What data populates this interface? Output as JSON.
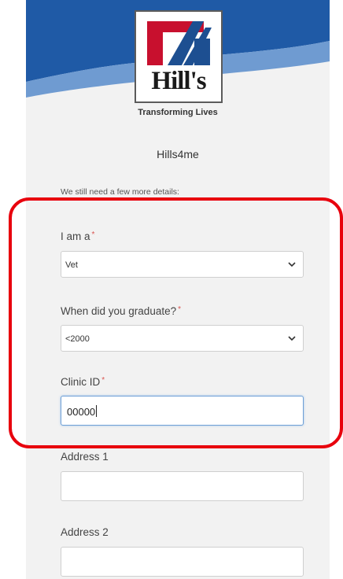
{
  "brand": {
    "logo_text": "Hill's",
    "tagline": "Transforming Lives",
    "colors": {
      "banner_blue": "#1f5aa6",
      "banner_light": "#6f9bd1",
      "logo_red": "#c8102e",
      "logo_blue": "#1d4f91"
    }
  },
  "site_name": "Hills4me",
  "intro": "We still need a few more details:",
  "form": {
    "role": {
      "label": "I am a",
      "required": "*",
      "value": "Vet"
    },
    "graduated": {
      "label": "When did you graduate?",
      "required": "*",
      "value": "<2000"
    },
    "clinic_id": {
      "label": "Clinic ID",
      "required": "*",
      "value": "00000"
    },
    "address1": {
      "label": "Address 1",
      "value": ""
    },
    "address2": {
      "label": "Address 2",
      "value": ""
    }
  },
  "annotation": {
    "color": "#e8000d"
  }
}
